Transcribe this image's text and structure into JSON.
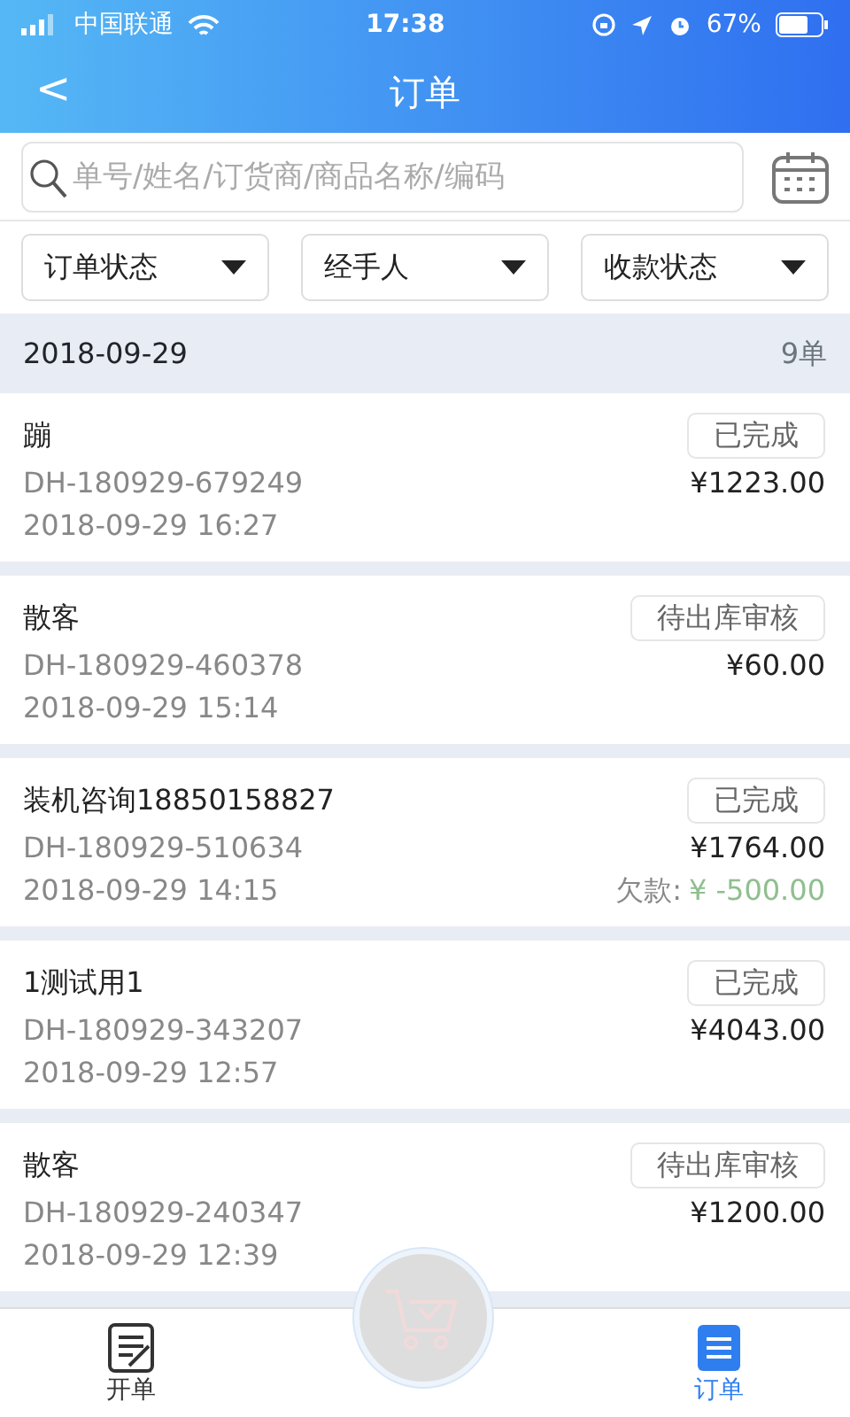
{
  "status_bar": {
    "carrier": "中国联通",
    "time": "17:38",
    "battery": "67%"
  },
  "header": {
    "back": "<",
    "title": "订单"
  },
  "search": {
    "placeholder": "单号/姓名/订货商/商品名称/编码"
  },
  "filters": [
    {
      "label": "订单状态"
    },
    {
      "label": "经手人"
    },
    {
      "label": "收款状态"
    }
  ],
  "group": {
    "date": "2018-09-29",
    "count": "9单"
  },
  "orders": [
    {
      "name": "蹦",
      "number": "DH-180929-679249",
      "time": "2018-09-29 16:27",
      "status": "已完成",
      "amount": "¥1223.00"
    },
    {
      "name": "散客",
      "number": "DH-180929-460378",
      "time": "2018-09-29 15:14",
      "status": "待出库审核",
      "amount": "¥60.00"
    },
    {
      "name": "装机咨询18850158827",
      "number": "DH-180929-510634",
      "time": "2018-09-29 14:15",
      "status": "已完成",
      "amount": "¥1764.00",
      "debt_label": "欠款:",
      "debt": "¥ -500.00"
    },
    {
      "name": "1测试用1",
      "number": "DH-180929-343207",
      "time": "2018-09-29 12:57",
      "status": "已完成",
      "amount": "¥4043.00"
    },
    {
      "name": "散客",
      "number": "DH-180929-240347",
      "time": "2018-09-29 12:39",
      "status": "待出库审核",
      "amount": "¥1200.00"
    }
  ],
  "tabs": [
    {
      "label": "开单",
      "kind": "edit",
      "selected": false
    },
    {
      "label": "订单",
      "kind": "list",
      "selected": true
    }
  ]
}
